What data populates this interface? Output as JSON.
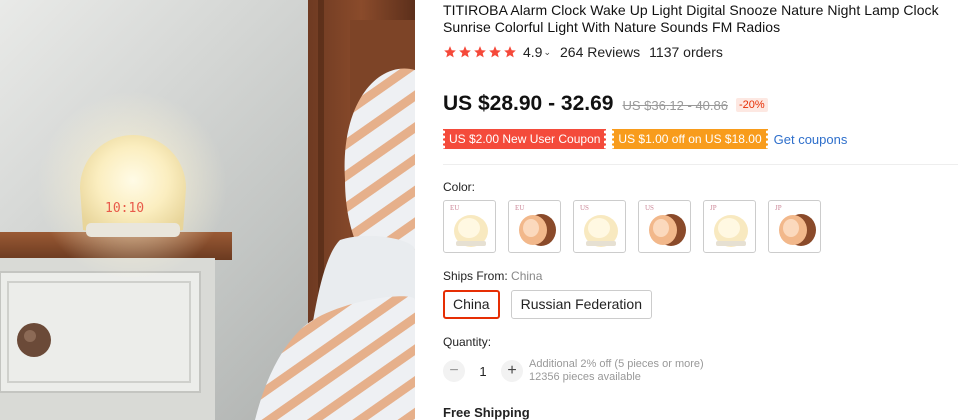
{
  "product": {
    "title": "TITIROBA Alarm Clock Wake Up Light Digital Snooze Nature Night Lamp Clock Sunrise Colorful Light With Nature Sounds FM Radios",
    "image_clock_display": "10:10"
  },
  "rating": {
    "stars": 5,
    "value": "4.9",
    "caret": "⌄",
    "reviews": "264 Reviews",
    "orders": "1137 orders",
    "star_color": "#f5493a"
  },
  "price": {
    "current": "US $28.90 - 32.69",
    "original": "US $36.12 - 40.86",
    "discount": "-20%"
  },
  "coupons": {
    "new_user": "US $2.00 New User Coupon",
    "store": "US $1.00 off on US $18.00",
    "get_coupons": "Get coupons"
  },
  "color": {
    "label": "Color:",
    "options": [
      {
        "tag": "EU",
        "icon": "wake-light-white"
      },
      {
        "tag": "EU",
        "icon": "wake-light-wood"
      },
      {
        "tag": "US",
        "icon": "wake-light-white"
      },
      {
        "tag": "US",
        "icon": "wake-light-wood"
      },
      {
        "tag": "JP",
        "icon": "wake-light-white"
      },
      {
        "tag": "JP",
        "icon": "wake-light-wood"
      }
    ]
  },
  "shipping": {
    "label": "Ships From:",
    "selected_value": "China",
    "options": [
      "China",
      "Russian Federation"
    ]
  },
  "quantity": {
    "label": "Quantity:",
    "value": "1",
    "minus": "−",
    "plus": "+",
    "promo": "Additional 2% off (5 pieces or more)",
    "available": "12356 pieces available"
  },
  "free_shipping": "Free Shipping",
  "colors": {
    "accent_red": "#e62e04",
    "coupon_red": "#f44b3b",
    "coupon_orange": "#f89c1c",
    "link_blue": "#2e6fcb"
  }
}
